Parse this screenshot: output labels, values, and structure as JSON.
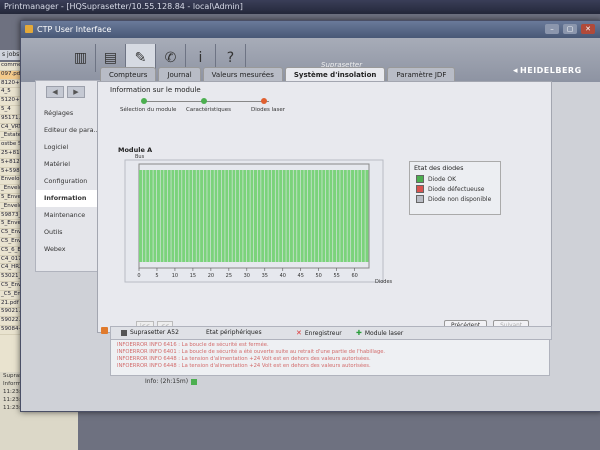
{
  "background": {
    "titlebar": "Printmanager - [HQSuprasetter/10.55.128.84 - local\\Admin]",
    "list_header": "s jobs",
    "list_items": [
      "commerc",
      "097.pdf",
      "8120+592",
      "4_5",
      "5120+592",
      "5_4",
      "95171.pdf",
      "C4_VRT_BP",
      "_Estate",
      "ostbe Suisse 2",
      "25+8120+593",
      "5+8120+593",
      "5+59873.pdf",
      "Enveloppe_Ne",
      "_Enveloppe_Nep",
      "5_Enveloppe_Nep",
      "_Enveloppe_Nep",
      "59873_C5_Envelop",
      "5_Enveloppe_Ne",
      "C5_Enveloppe_Nep",
      "C5_Enveloppe_Ne",
      "C5_6_Enveloppe",
      "C4_017_Envelopp",
      "C4_HR2_Envelop",
      "53021_C5_6_Envelop",
      "C5_Enveloppe_Nep",
      "_C5_Enveloppe_N",
      "21.pdf",
      "59021.pdf",
      "59022.pdf",
      "59084+59085.pdf"
    ],
    "bottom_lines": [
      "Suprasetter A52",
      "Informations  # Aut",
      "11:23:45 05/28/25",
      "11:23:40 05/28/25",
      "11:23:40 05/28/25"
    ],
    "right_strip": "mmer"
  },
  "window": {
    "title": "CTP User Interface",
    "controls": [
      "–",
      "▢",
      "✕"
    ]
  },
  "toolbar": {
    "buttons": [
      {
        "name": "jobs-icon",
        "glyph": "▥",
        "active": false
      },
      {
        "name": "save-icon",
        "glyph": "▤",
        "active": false
      },
      {
        "name": "wrench-icon",
        "glyph": "✎",
        "active": true
      },
      {
        "name": "satellite-icon",
        "glyph": "✆",
        "active": false
      },
      {
        "name": "info-icon",
        "glyph": "i",
        "active": false
      },
      {
        "name": "help-icon",
        "glyph": "?",
        "active": false
      }
    ],
    "product": "Suprasetter",
    "brand": "HEIDELBERG"
  },
  "nav": {
    "items": [
      {
        "label": "Réglages",
        "active": false
      },
      {
        "label": "Editeur de para...",
        "active": false
      },
      {
        "label": "Logiciel",
        "active": false
      },
      {
        "label": "Matériel",
        "active": false
      },
      {
        "label": "Configuration",
        "active": false
      },
      {
        "label": "Information",
        "active": true
      },
      {
        "label": "Maintenance",
        "active": false
      },
      {
        "label": "Outils",
        "active": false
      },
      {
        "label": "Webex",
        "active": false
      }
    ]
  },
  "tabs": [
    {
      "label": "Compteurs",
      "active": false
    },
    {
      "label": "Journal",
      "active": false
    },
    {
      "label": "Valeurs mesurées",
      "active": false
    },
    {
      "label": "Système d'insolation",
      "active": true
    },
    {
      "label": "Paramètre JDF",
      "active": false
    }
  ],
  "main": {
    "section_title": "Information sur le module",
    "wizard": [
      "Sélection du module",
      "Caractéristiques",
      "Diodes laser"
    ],
    "module_title": "Module A",
    "buttons": {
      "previous": "Précédent",
      "next": "Suivant"
    },
    "pager": [
      "|<<",
      "<<"
    ]
  },
  "chart_data": {
    "type": "heatmap",
    "title": "",
    "xlabel": "Diodes",
    "ylabel": "Bus",
    "x_ticks": [
      0,
      5,
      10,
      15,
      20,
      25,
      30,
      35,
      40,
      45,
      50,
      55,
      60
    ],
    "xlim": [
      0,
      64
    ],
    "rows": 1,
    "cells": [
      {
        "state": "OK",
        "count": 64
      }
    ],
    "colors": {
      "ok": "#7bd37b",
      "defective": "#d9534f",
      "unavailable": "#b9bcc4"
    }
  },
  "legend": {
    "title": "Etat des diodes",
    "items": [
      {
        "label": "Diode OK",
        "color": "#4caf50"
      },
      {
        "label": "Diode défectueuse",
        "color": "#d9534f"
      },
      {
        "label": "Diode non disponible",
        "color": "#b9bcc4"
      }
    ]
  },
  "status": {
    "segments": [
      {
        "label": "Suprasetter A52",
        "icon": "device-icon",
        "color": "#555"
      },
      {
        "label": "Etat périphériques",
        "icon": "",
        "color": ""
      },
      {
        "label": "Enregistreur",
        "icon": "error-x-icon",
        "color": "#d33"
      },
      {
        "label": "Module laser",
        "icon": "ok-check-icon",
        "color": "#2a9d3a"
      }
    ],
    "log": [
      "INFOERROR INFO 6416 : La boucle de sécurité est fermée.",
      "INFOERROR INFO 6401 : La boucle de sécurité a été ouverte suite au retrait d'une partie de l'habillage.",
      "INFOERROR INFO 6448 : La tension d'alimentation +24 Volt est en dehors des valeurs autorisées.",
      "INFOERROR INFO 6448 : La tension d'alimentation +24 Volt est en dehors des valeurs autorisées."
    ],
    "info": "Info: (2h:15m)"
  }
}
